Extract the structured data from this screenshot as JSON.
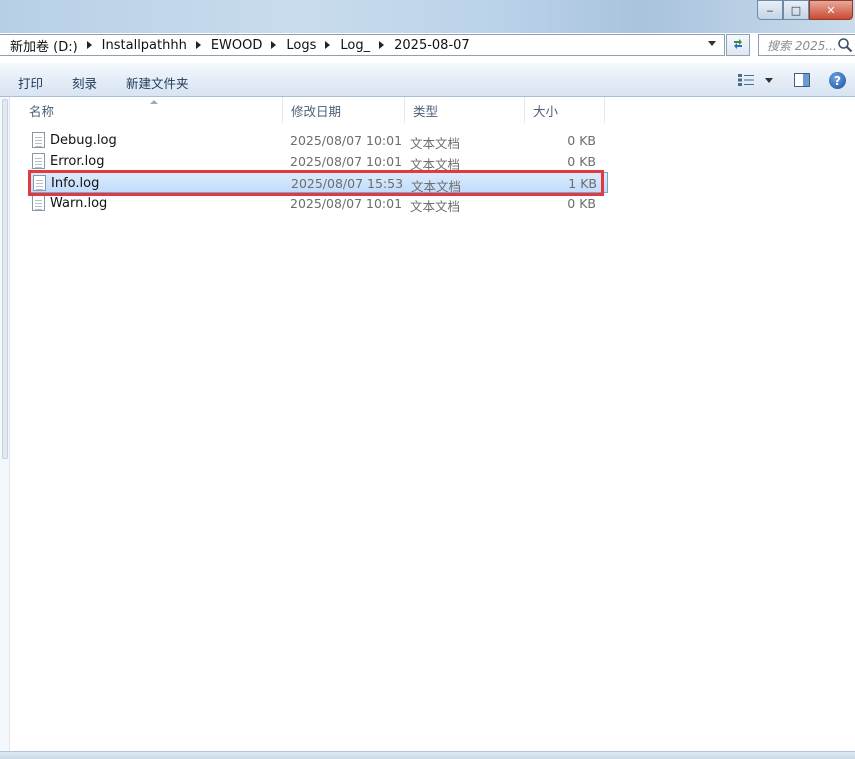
{
  "window": {
    "minimize_glyph": "‒",
    "maximize_glyph": "□",
    "close_glyph": "✕"
  },
  "address": {
    "crumbs": [
      "新加卷 (D:)",
      "Installpathhh",
      "EWOOD",
      "Logs",
      "Log_",
      "2025-08-07"
    ],
    "search_placeholder": "搜索 2025..."
  },
  "toolbar": {
    "print_label": "打印",
    "burn_label": "刻录",
    "new_folder_label": "新建文件夹",
    "help_glyph": "?"
  },
  "columns": {
    "name": "名称",
    "date": "修改日期",
    "type": "类型",
    "size": "大小"
  },
  "files": [
    {
      "name": "Debug.log",
      "date": "2025/08/07 10:01",
      "type": "文本文档",
      "size": "0 KB"
    },
    {
      "name": "Error.log",
      "date": "2025/08/07 10:01",
      "type": "文本文档",
      "size": "0 KB"
    },
    {
      "name": "Info.log",
      "date": "2025/08/07 15:53",
      "type": "文本文档",
      "size": "1 KB"
    },
    {
      "name": "Warn.log",
      "date": "2025/08/07 10:01",
      "type": "文本文档",
      "size": "0 KB"
    }
  ],
  "selected_file": "Info.log",
  "colors": {
    "selection_bg": "#c1dcfc",
    "highlight_border": "#e03a40",
    "titlebar": "#b9d1e8"
  }
}
